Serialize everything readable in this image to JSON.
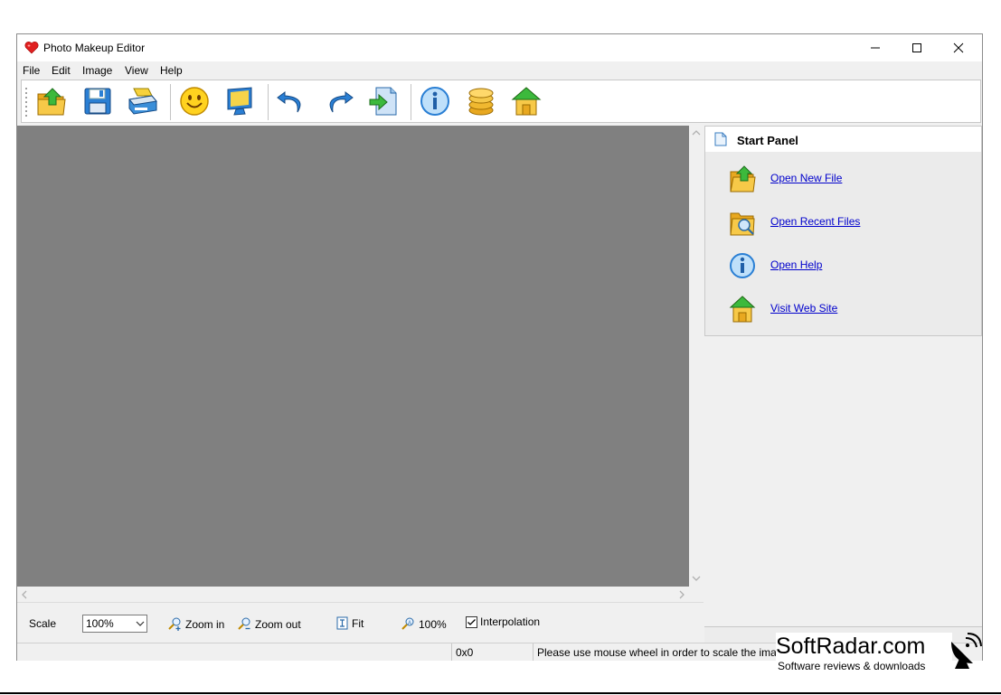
{
  "window": {
    "title": "Photo Makeup Editor"
  },
  "menu": [
    "File",
    "Edit",
    "Image",
    "View",
    "Help"
  ],
  "toolbar": {
    "buttons": [
      {
        "icon": "open-folder-icon"
      },
      {
        "icon": "save-floppy-icon"
      },
      {
        "icon": "scanner-icon"
      },
      {
        "icon": "smiley-face-icon"
      },
      {
        "icon": "monitor-icon"
      },
      {
        "icon": "undo-icon"
      },
      {
        "icon": "redo-icon"
      },
      {
        "icon": "export-document-icon"
      },
      {
        "icon": "info-icon"
      },
      {
        "icon": "coins-icon"
      },
      {
        "icon": "home-icon"
      }
    ]
  },
  "start_panel": {
    "title": "Start Panel",
    "links": [
      {
        "label": "Open New File",
        "icon": "open-folder-icon"
      },
      {
        "label": "Open Recent Files",
        "icon": "recent-files-icon"
      },
      {
        "label": "Open Help",
        "icon": "info-icon"
      },
      {
        "label": "Visit Web Site",
        "icon": "home-icon"
      }
    ]
  },
  "bottom_bar": {
    "scale_label": "Scale",
    "scale_value": "100%",
    "zoom_in": "Zoom in",
    "zoom_out": "Zoom out",
    "fit": "Fit",
    "actual": "100%",
    "interpolation": "Interpolation",
    "interpolation_checked": true
  },
  "statusbar": {
    "size": "0x0",
    "hint": "Please use mouse wheel in order to scale the image"
  },
  "watermark": {
    "brand": "SoftRadar.com",
    "tagline": "Software reviews & downloads"
  },
  "colors": {
    "canvas": "#808080",
    "link": "#0000cc",
    "title_heart": "#e02020"
  }
}
